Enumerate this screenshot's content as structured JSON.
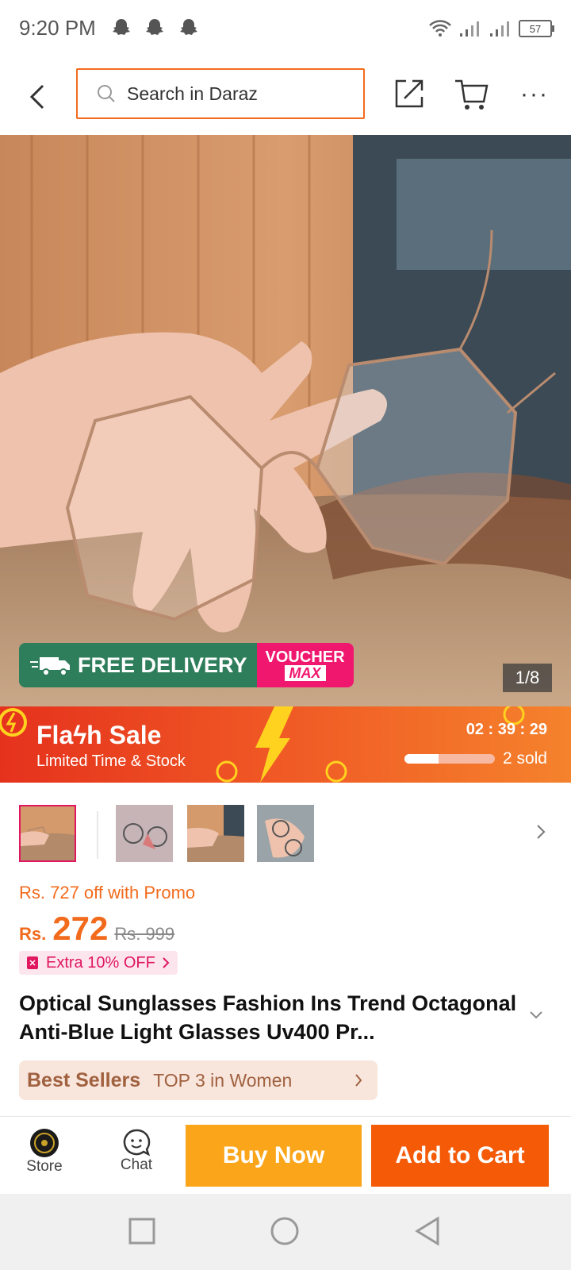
{
  "status_bar": {
    "time": "9:20 PM",
    "battery": "57"
  },
  "header": {
    "search_placeholder": "Search in Daraz"
  },
  "hero": {
    "image_counter": "1/8",
    "free_delivery": "FREE DELIVERY",
    "free_badge": "FREE",
    "voucher": "VOUCHER",
    "voucher_max": "MAX"
  },
  "flash_sale": {
    "title": "Flaϟh Sale",
    "subtitle": "Limited Time & Stock",
    "countdown": "02 : 39 : 29",
    "sold": "2 sold",
    "sold_progress": 0.38
  },
  "product": {
    "promo_text": "Rs. 727 off with Promo",
    "currency": "Rs.",
    "price": "272",
    "original_price": "Rs. 999",
    "extra_discount": "Extra 10% OFF",
    "title": "Optical Sunglasses Fashion Ins Trend Octagonal Anti-Blue Light Glasses Uv400 Pr...",
    "best_sellers_label": "Best Sellers",
    "best_sellers_rank": "TOP 3 in Women"
  },
  "bottom_bar": {
    "store_label": "Store",
    "chat_label": "Chat",
    "buy_now": "Buy Now",
    "add_to_cart": "Add to Cart"
  },
  "colors": {
    "accent": "#f26b1d",
    "buy_now": "#fba51a",
    "add_to_cart": "#f55a07",
    "pink": "#e0175f"
  }
}
